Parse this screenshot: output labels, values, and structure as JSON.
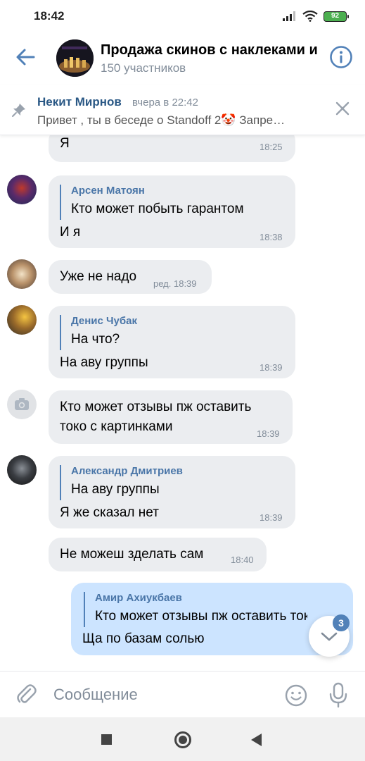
{
  "status_bar": {
    "time": "18:42",
    "battery": "92"
  },
  "header": {
    "title": "Продажа скинов с наклеками и",
    "subtitle": "150 участников"
  },
  "pinned": {
    "author": "Некит Мирнов",
    "date": "вчера в 22:42",
    "text": "Привет , ты в беседе о Standoff 2🤡 Запре…"
  },
  "messages": [
    {
      "text": "Я",
      "time": "18:25"
    },
    {
      "reply_name": "Арсен Матоян",
      "reply_text": "Кто может побыть гарантом",
      "text": "И я",
      "time": "18:38"
    },
    {
      "text": "Уже не надо",
      "time": "ред. 18:39"
    },
    {
      "reply_name": "Денис Чубак",
      "reply_text": "На что?",
      "text": "На аву группы",
      "time": "18:39"
    },
    {
      "text_line1": "Кто может отзывы пж оставить",
      "text_line2": "токо с картинками",
      "time": "18:39"
    },
    {
      "reply_name": "Александр Дмитриев",
      "reply_text": "На аву группы",
      "text": "Я же сказал нет",
      "time": "18:39"
    },
    {
      "text": "Не можеш зделать сам",
      "time": "18:40"
    },
    {
      "reply_name": "Амир Ахиукбаев",
      "reply_text": "Кто может отзывы пж оставить токо с картинками",
      "text": "Ща по базам солью"
    }
  ],
  "scroll_badge": "3",
  "composer": {
    "placeholder": "Сообщение"
  },
  "colors": {
    "accent": "#5181b8",
    "bubble_in": "#ebedf0",
    "bubble_out": "#cce4ff",
    "link": "#2a5885"
  }
}
